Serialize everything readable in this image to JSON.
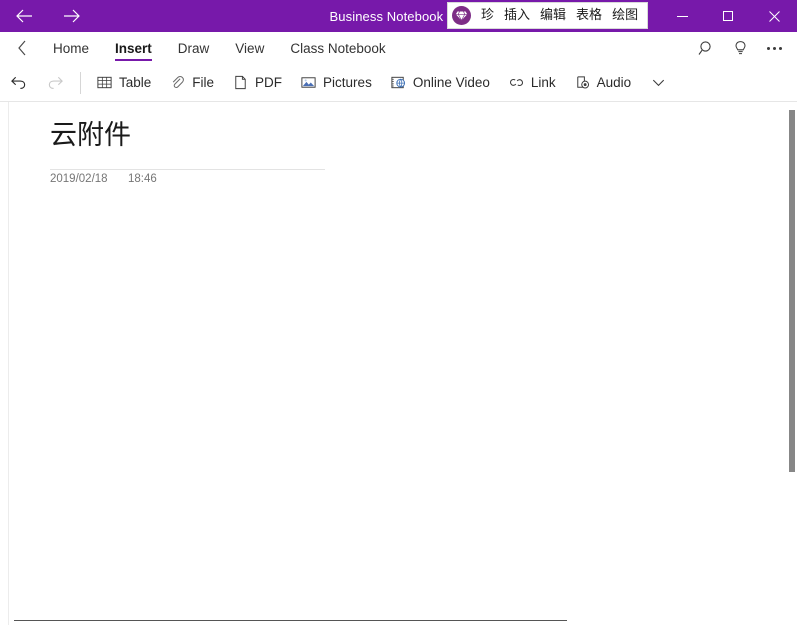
{
  "titlebar": {
    "back_label": "Back",
    "forward_label": "Forward",
    "title": "Business Notebook » N",
    "minimize_label": "Minimize",
    "maximize_label": "Maximize",
    "close_label": "Close",
    "background_color": "#7719aa",
    "text_color": "#ffffff"
  },
  "ime_overlay": {
    "logo_icon": "diamond-gem-icon",
    "items": [
      {
        "label": "珍"
      },
      {
        "label": "插入"
      },
      {
        "label": "编辑"
      },
      {
        "label": "表格"
      },
      {
        "label": "绘图"
      }
    ],
    "background_color": "#ffffff",
    "border_color": "#d9d9d9"
  },
  "ribbon": {
    "back_icon": "chevron-left-icon",
    "tabs": [
      {
        "label": "Home",
        "active": false
      },
      {
        "label": "Insert",
        "active": true
      },
      {
        "label": "Draw",
        "active": false
      },
      {
        "label": "View",
        "active": false
      },
      {
        "label": "Class Notebook",
        "active": false
      }
    ],
    "active_underline_color": "#7719aa",
    "right_buttons": [
      {
        "name": "search-icon",
        "label": "Search"
      },
      {
        "name": "lightbulb-icon",
        "label": "Tell me what you want to do"
      },
      {
        "name": "more-options-icon",
        "label": "More options"
      }
    ]
  },
  "toolbar": {
    "undo_label": "Undo",
    "redo_label": "Redo",
    "redo_disabled": true,
    "items": [
      {
        "label": "Table",
        "icon": "table-icon"
      },
      {
        "label": "File",
        "icon": "paperclip-icon"
      },
      {
        "label": "PDF",
        "icon": "pdf-page-icon"
      },
      {
        "label": "Pictures",
        "icon": "pictures-icon"
      },
      {
        "label": "Online Video",
        "icon": "online-video-icon"
      },
      {
        "label": "Link",
        "icon": "link-icon"
      },
      {
        "label": "Audio",
        "icon": "audio-icon"
      }
    ],
    "overflow_icon": "chevron-down-icon",
    "overflow_label": "More commands"
  },
  "page": {
    "title": "云附件",
    "date": "2019/02/18",
    "time": "18:46"
  },
  "scrollbar": {
    "name": "vertical-scrollbar",
    "thumb_color": "#878787"
  }
}
